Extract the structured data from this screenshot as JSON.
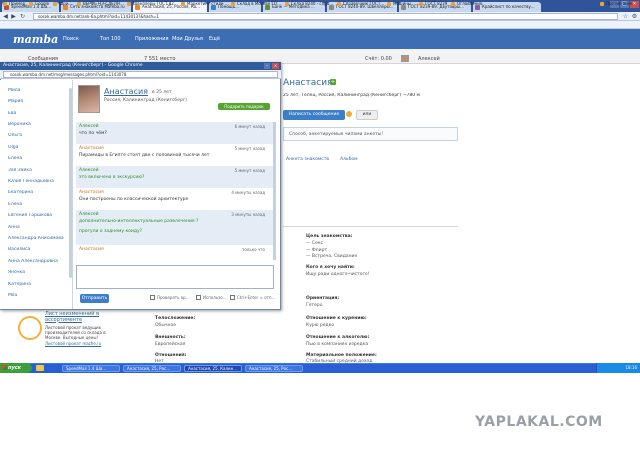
{
  "browser": {
    "tabs": [
      {
        "title": "SpeedMail 1.4 Ша...",
        "color": "#c94f2a"
      },
      {
        "title": "Сеть знакомств Mamba.ru",
        "color": "#e6852a"
      },
      {
        "title": "Анастасия, 25, Россия, Ка...",
        "color": "#e6852a",
        "active": true
      },
      {
        "title": "Помощь...",
        "color": "#3d7ec9"
      },
      {
        "title": "Банк — Методика ...",
        "color": "#5c8e3b"
      },
      {
        "title": "ГОСТ 8240-89. Швеллеры...",
        "color": "#888888"
      },
      {
        "title": "ГОСТ 8239-89. Двутавры...",
        "color": "#888888"
      },
      {
        "title": "Крайслист по качеству...",
        "color": "#8a5aa0"
      }
    ],
    "url": "sosok.wamba.dm.net/ank-6a.phtml?oid=1143013?&hash=1",
    "bookmarks": [
      "Пример",
      "Google",
      "Шрифты",
      "ВЕРФЬ НЭ-СДЕЛНУЮ",
      "Швеллеры ГОСТ 8240-89",
      "Маркетинг стили в сети",
      "Склад в Москве ГОСТ 8240-89",
      "Склад 8240 - справочник",
      "Справочник ГОСТ 8240",
      "Машины",
      "ГОСТ 8239",
      "Оглавление",
      "Прочие закладки"
    ]
  },
  "mamba": {
    "logo": "mamba",
    "nav": [
      "Поиск",
      "Топ 100",
      "Приложения",
      "Мои Друзья",
      "Ещё"
    ],
    "sub": {
      "messages": "Сообщения",
      "visitors_count": "7 551 место",
      "balance": "Счёт: 0.00",
      "user": "Алексей"
    }
  },
  "profile": {
    "name": "Анастасия",
    "info": "25 лет, Телец, Россия, Калининград (Кенигсберг) ~780 м",
    "write_button": "Написать сообщение",
    "or_label": "или",
    "status_placeholder": "Способ, анкетируемые чипами анкеты!",
    "tabs": [
      "Анкета знакомств",
      "Альбом"
    ],
    "fields": [
      {
        "label": "Цель знакомства:",
        "value": "— Секс\n— Флирт\n— Встреча, Свидание"
      },
      {
        "label": "Кого я хочу найти:",
        "value": "Ищу ради одного-чистого!"
      },
      {
        "label": "Ориентация:",
        "value": "Гетеро"
      },
      {
        "label": "Отношение к курению:",
        "value": "Курю редко"
      },
      {
        "label": "Отношение к алкоголю:",
        "value": "Пью в компаниях изредка"
      },
      {
        "label": "Материальное положение:",
        "value": "Стабильный средний доход"
      },
      {
        "label": "Телосложение:",
        "value": "Обычное"
      },
      {
        "label": "Внешность:",
        "value": "Европейская"
      },
      {
        "label": "Отношения:",
        "value": "Нет"
      }
    ]
  },
  "ad": {
    "title": "Лист неизменений в ассортименте",
    "lines": [
      "Листовой прокат ведущих",
      "производителей со склада в",
      "Москве. Выгодные цены!",
      "Листовой прокат mazhe.ru"
    ]
  },
  "chat": {
    "window_title": "Анастасия, 25, Калининград (Кенигсберг) - Google Chrome",
    "url": "sosok.wamba.dm.net/msg/messages.phtml?oid=1143078",
    "contacts": [
      "Мила",
      "Мария",
      "Ева",
      "Вероника",
      "Ольга",
      "Olga",
      "Елена",
      "Зая Зайка",
      "Юлия Геннадьевна",
      "Екатерина",
      "Елена",
      "Евгения Горшкова",
      "Анна",
      "Александра Анисимова",
      "Василиса",
      "Анна Александровна",
      "Яночка",
      "Катерина",
      "Mila"
    ],
    "name": "Анастасия",
    "age": "в 25 лет",
    "location": "Россия, Калининград (Кенигсберг)",
    "gift_button": "Подарить подарок",
    "messages": [
      {
        "who": "Алексей",
        "me": true,
        "time": "6 минут назад",
        "text": "что по чём?",
        "shade": true
      },
      {
        "who": "Анастасия",
        "me": false,
        "time": "5 минут назад",
        "text": "Пирамиды в Египте стоят две с половиной тысячи лет",
        "shade": false
      },
      {
        "who": "Алексей",
        "me": true,
        "time": "5 минут назад",
        "text": "это включено в экскурсию?",
        "shade": true
      },
      {
        "who": "Анастасия",
        "me": false,
        "time": "4 минуты назад",
        "text": "Они построены по классической архитектуре",
        "shade": false
      },
      {
        "who": "Алексей",
        "me": true,
        "time": "3 минуты назад",
        "text": "дополнительно-интеллектуальные развлечения ?\n\nпрогули о заднему коиду?",
        "shade": true
      },
      {
        "who": "Анастасия",
        "me": false,
        "time": "только что",
        "text": "",
        "shade": false
      }
    ],
    "send_button": "Отправить",
    "options": [
      "Проверять орфографию",
      "Использовать",
      "Ctrl+Enter = отправить"
    ]
  },
  "taskbar": {
    "start": "пуск",
    "tasks": [
      "SpeedMail 1.4 Ша...",
      "Анастасия, 25, Рос...",
      "Анастасия, 25, Калин...",
      "Анастасия, 25, Рос..."
    ],
    "clock": "18:16"
  },
  "watermark": "YAPLAKAL.COM"
}
